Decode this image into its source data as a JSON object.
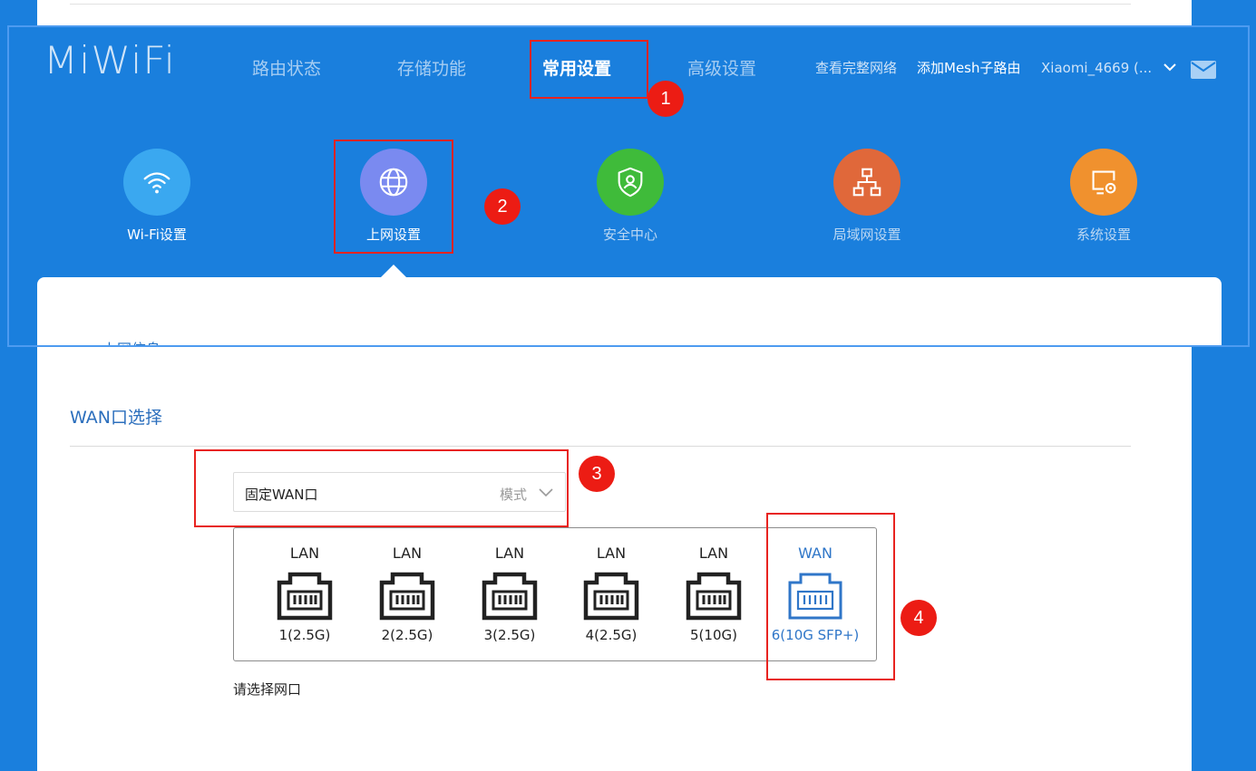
{
  "header": {
    "logo": "MiWiFi",
    "nav": [
      "路由状态",
      "存储功能",
      "常用设置",
      "高级设置"
    ],
    "active_nav": "常用设置",
    "view_network": "查看完整网络",
    "add_mesh": "添加Mesh子路由",
    "device_name": "Xiaomi_4669 (..."
  },
  "tiles": [
    {
      "label": "Wi-Fi设置",
      "icon": "wifi-icon",
      "color": "#3aa8f0"
    },
    {
      "label": "上网设置",
      "icon": "globe-icon",
      "color": "#7a8af0"
    },
    {
      "label": "安全中心",
      "icon": "shield-icon",
      "color": "#3fbb3a"
    },
    {
      "label": "局域网设置",
      "icon": "network-icon",
      "color": "#e0683a"
    },
    {
      "label": "系统设置",
      "icon": "system-settings-icon",
      "color": "#f0912e"
    }
  ],
  "clipped_label": "上网信息",
  "wan": {
    "section_title": "WAN口选择",
    "mode_value": "固定WAN口",
    "mode_hint": "模式",
    "ports": [
      {
        "type": "LAN",
        "name": "1(2.5G)"
      },
      {
        "type": "LAN",
        "name": "2(2.5G)"
      },
      {
        "type": "LAN",
        "name": "3(2.5G)"
      },
      {
        "type": "LAN",
        "name": "4(2.5G)"
      },
      {
        "type": "LAN",
        "name": "5(10G)"
      },
      {
        "type": "WAN",
        "name": "6(10G SFP+)"
      }
    ],
    "note": "请选择网口"
  },
  "annotations": [
    "1",
    "2",
    "3",
    "4"
  ],
  "colors": {
    "brand_blue": "#1a7fdd",
    "annotation_red": "#e8231f",
    "wan_blue": "#2f76c8"
  }
}
